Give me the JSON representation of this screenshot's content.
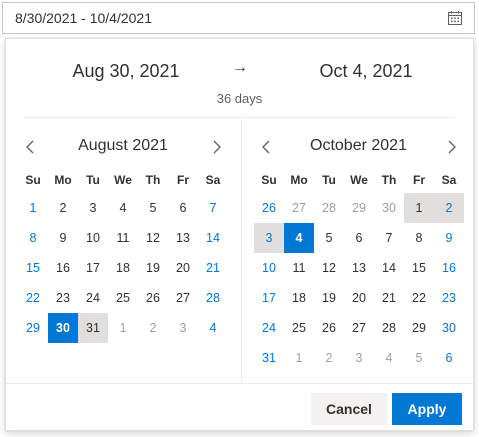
{
  "range_input": {
    "value": "8/30/2021 - 10/4/2021",
    "icon": "calendar-icon"
  },
  "summary": {
    "start_date": "Aug 30, 2021",
    "arrow": "→",
    "end_date": "Oct 4, 2021",
    "duration": "36 days"
  },
  "weekdays": [
    "Su",
    "Mo",
    "Tu",
    "We",
    "Th",
    "Fr",
    "Sa"
  ],
  "left_month": {
    "title": "August 2021",
    "prev_icon": "chevron-left-icon",
    "next_icon": "chevron-right-icon",
    "weeks": [
      [
        {
          "d": "1",
          "t": "weekend"
        },
        {
          "d": "2"
        },
        {
          "d": "3"
        },
        {
          "d": "4"
        },
        {
          "d": "5"
        },
        {
          "d": "6"
        },
        {
          "d": "7",
          "t": "weekend"
        }
      ],
      [
        {
          "d": "8",
          "t": "weekend"
        },
        {
          "d": "9"
        },
        {
          "d": "10"
        },
        {
          "d": "11"
        },
        {
          "d": "12"
        },
        {
          "d": "13"
        },
        {
          "d": "14",
          "t": "weekend"
        }
      ],
      [
        {
          "d": "15",
          "t": "weekend"
        },
        {
          "d": "16"
        },
        {
          "d": "17"
        },
        {
          "d": "18"
        },
        {
          "d": "19"
        },
        {
          "d": "20"
        },
        {
          "d": "21",
          "t": "weekend"
        }
      ],
      [
        {
          "d": "22",
          "t": "weekend"
        },
        {
          "d": "23"
        },
        {
          "d": "24"
        },
        {
          "d": "25"
        },
        {
          "d": "26"
        },
        {
          "d": "27"
        },
        {
          "d": "28",
          "t": "weekend"
        }
      ],
      [
        {
          "d": "29",
          "t": "weekend"
        },
        {
          "d": "30",
          "t": "selected"
        },
        {
          "d": "31",
          "t": "inrange"
        },
        {
          "d": "1",
          "t": "muted"
        },
        {
          "d": "2",
          "t": "muted"
        },
        {
          "d": "3",
          "t": "muted"
        },
        {
          "d": "4",
          "t": "weekend"
        }
      ]
    ]
  },
  "right_month": {
    "title": "October 2021",
    "prev_icon": "chevron-left-icon",
    "next_icon": "chevron-right-icon",
    "weeks": [
      [
        {
          "d": "26",
          "t": "weekend"
        },
        {
          "d": "27",
          "t": "muted"
        },
        {
          "d": "28",
          "t": "muted"
        },
        {
          "d": "29",
          "t": "muted"
        },
        {
          "d": "30",
          "t": "muted"
        },
        {
          "d": "1",
          "t": "inrange"
        },
        {
          "d": "2",
          "t": "weekend inrange"
        }
      ],
      [
        {
          "d": "3",
          "t": "weekend inrange"
        },
        {
          "d": "4",
          "t": "selected"
        },
        {
          "d": "5"
        },
        {
          "d": "6"
        },
        {
          "d": "7"
        },
        {
          "d": "8"
        },
        {
          "d": "9",
          "t": "weekend"
        }
      ],
      [
        {
          "d": "10",
          "t": "weekend"
        },
        {
          "d": "11"
        },
        {
          "d": "12"
        },
        {
          "d": "13"
        },
        {
          "d": "14"
        },
        {
          "d": "15"
        },
        {
          "d": "16",
          "t": "weekend"
        }
      ],
      [
        {
          "d": "17",
          "t": "weekend"
        },
        {
          "d": "18"
        },
        {
          "d": "19"
        },
        {
          "d": "20"
        },
        {
          "d": "21"
        },
        {
          "d": "22"
        },
        {
          "d": "23",
          "t": "weekend"
        }
      ],
      [
        {
          "d": "24",
          "t": "weekend"
        },
        {
          "d": "25"
        },
        {
          "d": "26"
        },
        {
          "d": "27"
        },
        {
          "d": "28"
        },
        {
          "d": "29"
        },
        {
          "d": "30",
          "t": "weekend"
        }
      ],
      [
        {
          "d": "31",
          "t": "weekend"
        },
        {
          "d": "1",
          "t": "muted"
        },
        {
          "d": "2",
          "t": "muted"
        },
        {
          "d": "3",
          "t": "muted"
        },
        {
          "d": "4",
          "t": "muted"
        },
        {
          "d": "5",
          "t": "muted"
        },
        {
          "d": "6",
          "t": "weekend"
        }
      ]
    ]
  },
  "footer": {
    "cancel_label": "Cancel",
    "apply_label": "Apply"
  },
  "colors": {
    "accent": "#0078d4",
    "range_fill": "#e1dfdd",
    "muted_text": "#a19f9d"
  }
}
